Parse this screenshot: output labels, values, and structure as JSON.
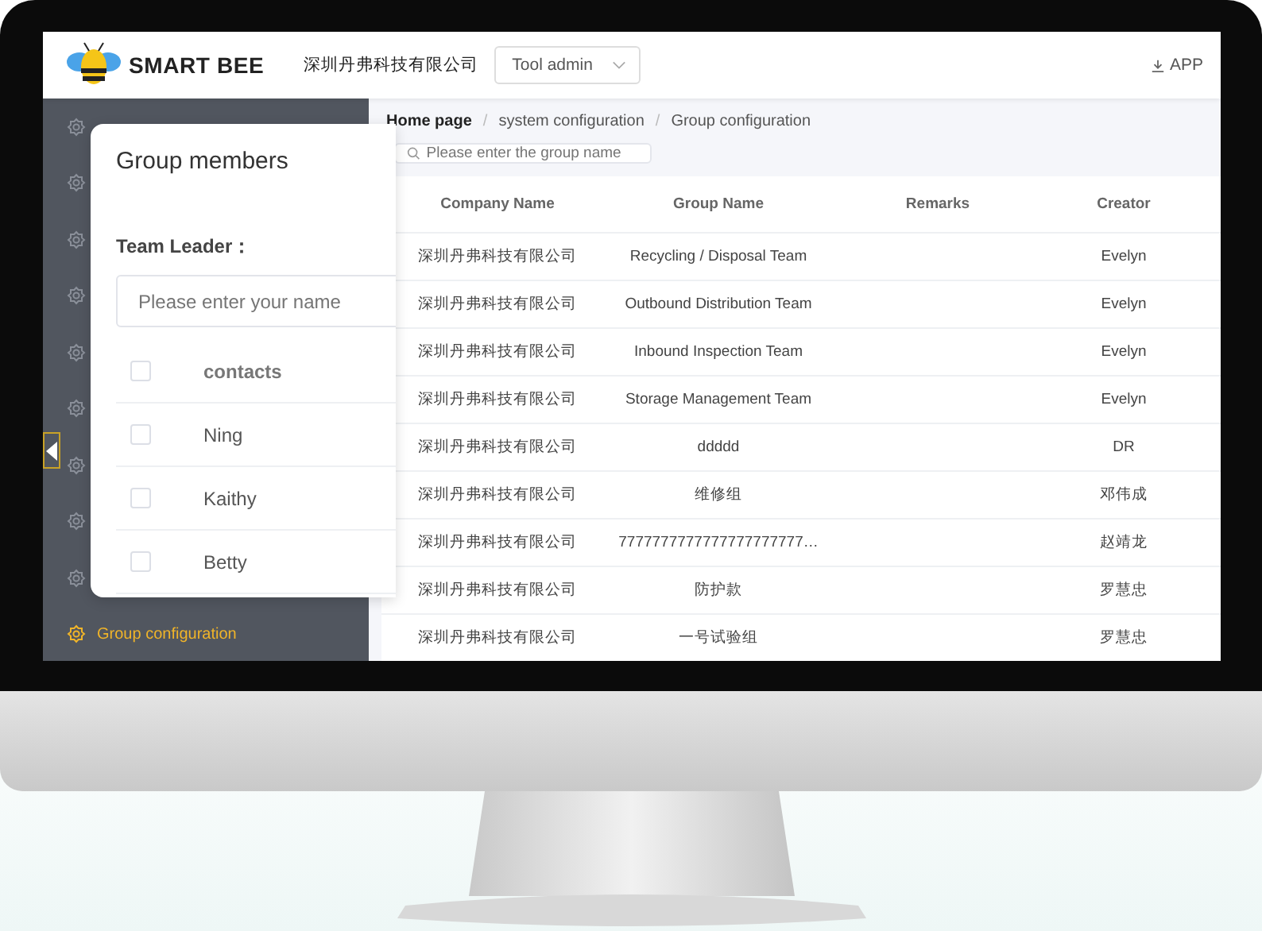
{
  "header": {
    "logo_text": "SMART BEE",
    "company": "深圳丹弗科技有限公司",
    "role_select": {
      "value": "Tool admin"
    },
    "app_link": "APP"
  },
  "sidebar": {
    "items": [
      {
        "selected": false
      },
      {
        "selected": false
      },
      {
        "selected": false
      },
      {
        "selected": false
      },
      {
        "selected": false
      },
      {
        "selected": false
      },
      {
        "selected": false
      },
      {
        "selected": false
      },
      {
        "selected": false
      },
      {
        "label": "Group configuration",
        "selected": true
      }
    ]
  },
  "breadcrumb": [
    {
      "label": "Home page"
    },
    {
      "separator": "/",
      "label": "system configuration"
    },
    {
      "separator": "/",
      "label": "Group configuration"
    }
  ],
  "search": {
    "placeholder": "Please enter the group name"
  },
  "table": {
    "columns": [
      "Company Name",
      "Group Name",
      "Remarks",
      "Creator"
    ],
    "rows": [
      [
        "深圳丹弗科技有限公司",
        "Recycling / Disposal Team",
        "",
        "Evelyn"
      ],
      [
        "深圳丹弗科技有限公司",
        "Outbound Distribution Team",
        "",
        "Evelyn"
      ],
      [
        "深圳丹弗科技有限公司",
        "Inbound Inspection Team",
        "",
        "Evelyn"
      ],
      [
        "深圳丹弗科技有限公司",
        "Storage Management Team",
        "",
        "Evelyn"
      ],
      [
        "深圳丹弗科技有限公司",
        "ddddd",
        "",
        "DR"
      ],
      [
        "深圳丹弗科技有限公司",
        "维修组",
        "",
        "邓伟成"
      ],
      [
        "深圳丹弗科技有限公司",
        "7777777777777777777777…",
        "",
        "赵靖龙"
      ],
      [
        "深圳丹弗科技有限公司",
        "防护款",
        "",
        "罗慧忠"
      ],
      [
        "深圳丹弗科技有限公司",
        "一号试验组",
        "",
        "罗慧忠"
      ]
    ]
  },
  "dialog": {
    "title": "Group members",
    "leader_label": "Team Leader：",
    "leader_field": {
      "placeholder": "Please enter your name"
    },
    "members_header": {
      "label": "contacts",
      "checked": false
    },
    "members": [
      {
        "name": "Ning",
        "checked": false
      },
      {
        "name": "Kaithy",
        "checked": false
      },
      {
        "name": "Betty",
        "checked": false
      }
    ]
  }
}
